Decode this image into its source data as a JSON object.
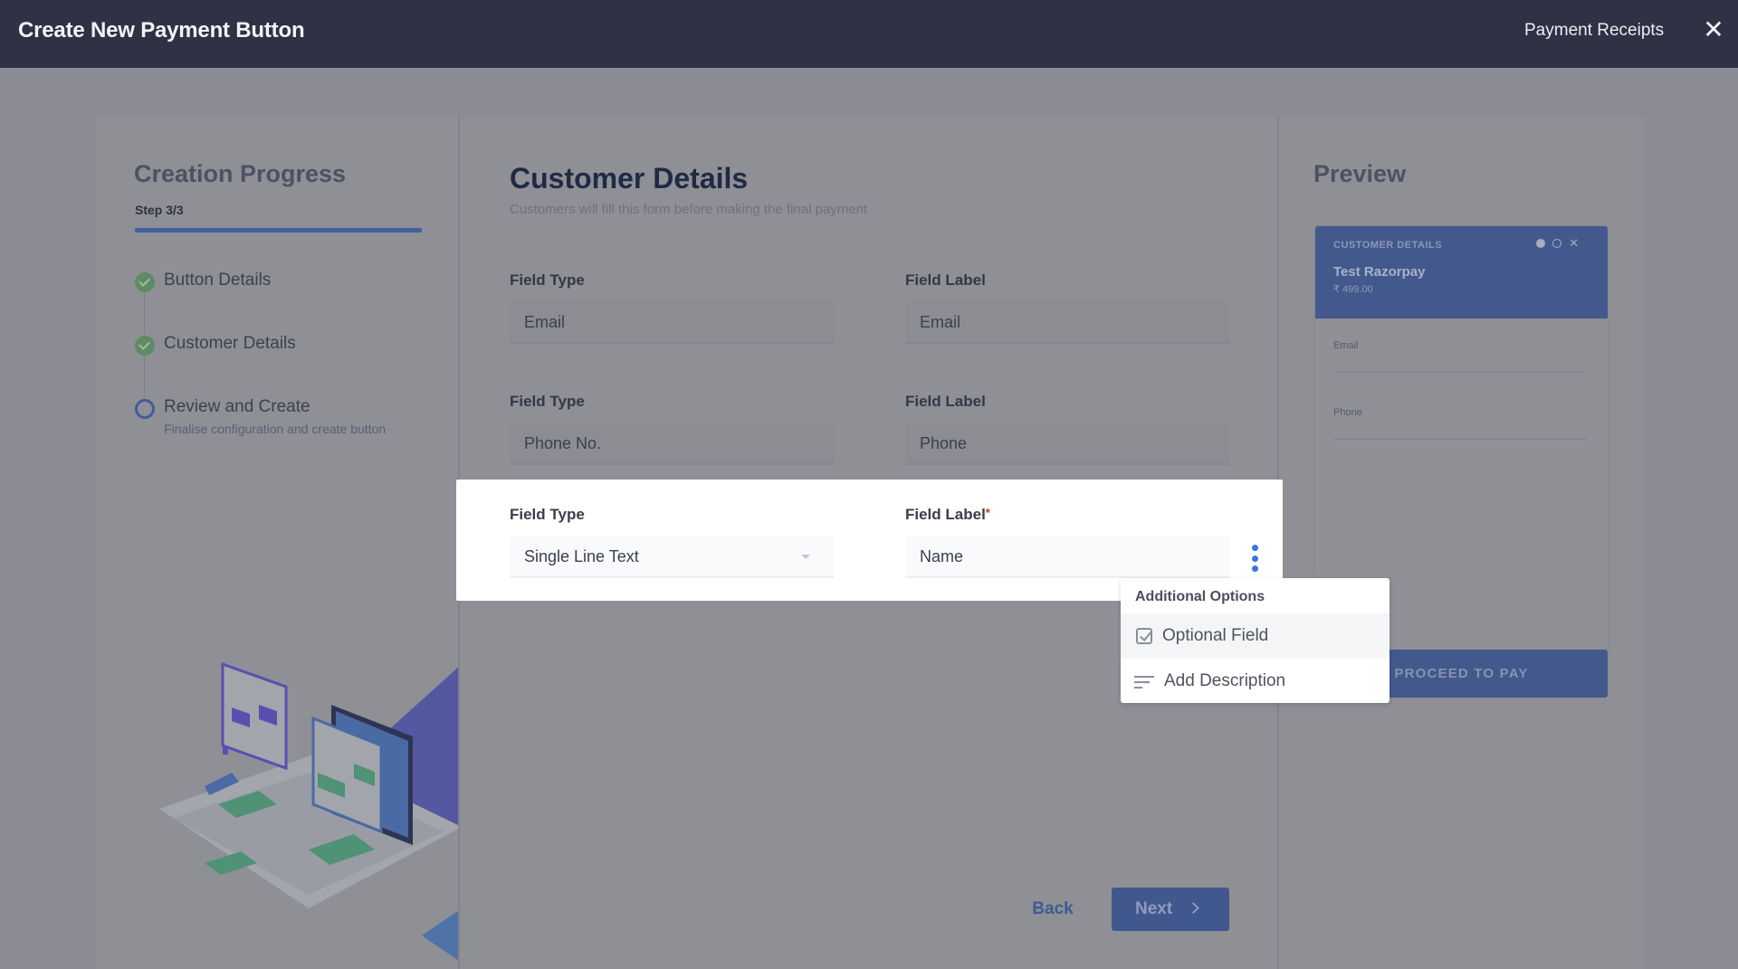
{
  "header": {
    "title": "Create New Payment Button",
    "receipts_link": "Payment Receipts",
    "close_icon": "close-icon"
  },
  "progress": {
    "title": "Creation Progress",
    "step_label": "Step 3/3",
    "progress_fraction": 1.0,
    "steps": [
      {
        "label": "Button Details",
        "status": "done",
        "icon": "check-circle-icon"
      },
      {
        "label": "Customer Details",
        "status": "done",
        "icon": "check-circle-icon"
      },
      {
        "label": "Review and Create",
        "sub": "Finalise configuration and create button",
        "status": "current",
        "icon": "empty-circle-icon"
      }
    ]
  },
  "customer_details": {
    "title": "Customer Details",
    "subtitle": "Customers will fill this form before making the final payment",
    "rows": [
      {
        "type_label": "Field Type",
        "type_value": "Email",
        "label_label": "Field Label",
        "label_value": "Email"
      },
      {
        "type_label": "Field Type",
        "type_value": "Phone No.",
        "label_label": "Field Label",
        "label_value": "Phone"
      },
      {
        "type_label": "Field Type",
        "type_value": "Single Line Text",
        "label_label": "Field Label",
        "required_mark": "*",
        "label_value": "Name"
      }
    ]
  },
  "additional_options": {
    "heading": "Additional Options",
    "items": [
      {
        "label": "Optional Field",
        "icon": "checkbox-icon"
      },
      {
        "label": "Add Description",
        "icon": "text-lines-icon"
      }
    ]
  },
  "preview": {
    "title": "Preview",
    "card_label": "CUSTOMER DETAILS",
    "merchant": "Test Razorpay",
    "amount": "₹ 499.00",
    "fields": [
      "Email",
      "Phone"
    ],
    "pay_button": "PROCEED TO PAY"
  },
  "footer": {
    "back": "Back",
    "next": "Next"
  },
  "colors": {
    "header_bg": "#2f3245",
    "accent": "#3b74e0",
    "brand_blue": "#43598d",
    "success": "#5f8b64",
    "required": "#c0392b"
  }
}
